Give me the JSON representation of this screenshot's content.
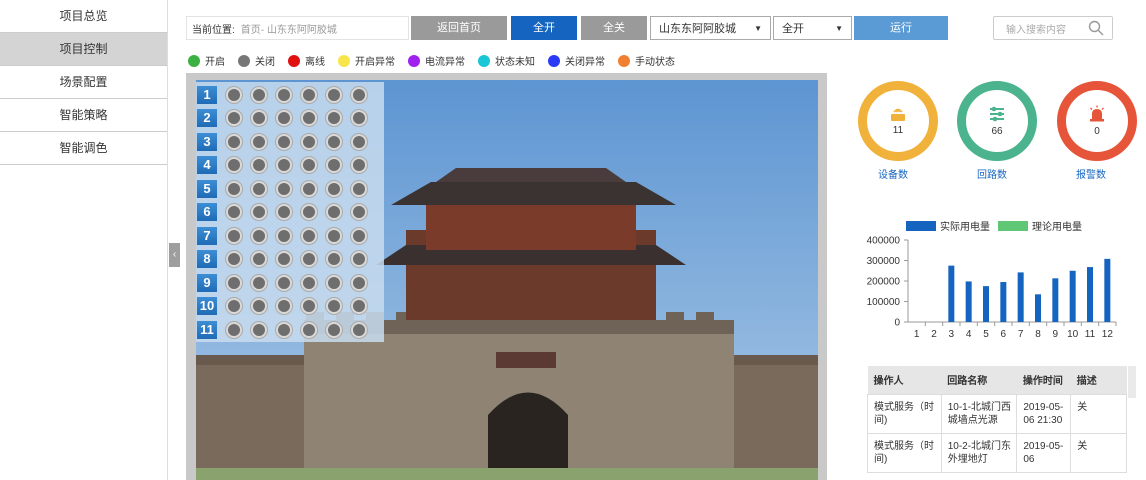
{
  "sidebar": {
    "items": [
      {
        "label": "项目总览"
      },
      {
        "label": "项目控制"
      },
      {
        "label": "场景配置"
      },
      {
        "label": "智能策略"
      },
      {
        "label": "智能调色"
      }
    ],
    "active_index": 1,
    "collapse_glyph": "‹"
  },
  "toolbar": {
    "location_label": "当前位置:",
    "location_path": "首页- 山东东阿阿胶城",
    "back_home": "返回首页",
    "all_on": "全开",
    "all_off": "全关",
    "project_select": "山东东阿阿胶城",
    "mode_select": "全开",
    "run": "运行"
  },
  "search": {
    "placeholder": "输入搜索内容",
    "icon": "search-icon"
  },
  "legend": [
    {
      "label": "开启",
      "color": "#3cb043"
    },
    {
      "label": "关闭",
      "color": "#777777"
    },
    {
      "label": "离线",
      "color": "#e01010"
    },
    {
      "label": "开启异常",
      "color": "#f7e54a"
    },
    {
      "label": "电流异常",
      "color": "#a020f0"
    },
    {
      "label": "状态未知",
      "color": "#19c6d6"
    },
    {
      "label": "关闭异常",
      "color": "#2a3af5"
    },
    {
      "label": "手动状态",
      "color": "#f08030"
    }
  ],
  "grid": {
    "rows": [
      "1",
      "2",
      "3",
      "4",
      "5",
      "6",
      "7",
      "8",
      "9",
      "10",
      "11"
    ],
    "circles_per_row": 6,
    "circle_color": "#6e6e6e"
  },
  "gauges": [
    {
      "label": "设备数",
      "value": "11",
      "color": "#f0b23a",
      "icon": "router-icon"
    },
    {
      "label": "回路数",
      "value": "66",
      "color": "#4bb38e",
      "icon": "sliders-icon"
    },
    {
      "label": "报警数",
      "value": "0",
      "color": "#e6553a",
      "icon": "alarm-icon"
    }
  ],
  "chart_data": {
    "type": "bar",
    "categories": [
      "1",
      "2",
      "3",
      "4",
      "5",
      "6",
      "7",
      "8",
      "9",
      "10",
      "11",
      "12"
    ],
    "series": [
      {
        "name": "实际用电量",
        "color": "#1565c0",
        "values": [
          0,
          0,
          275000,
          198000,
          175000,
          195000,
          242000,
          135000,
          213000,
          250000,
          268000,
          308000
        ]
      },
      {
        "name": "理论用电量",
        "color": "#5fc776",
        "values": [
          0,
          0,
          0,
          0,
          0,
          0,
          0,
          0,
          0,
          0,
          0,
          0
        ]
      }
    ],
    "yticks": [
      "400000",
      "300000",
      "200000",
      "100000",
      "0"
    ],
    "ylim": [
      0,
      400000
    ],
    "legend_position": "top"
  },
  "table": {
    "headers": [
      "操作人",
      "回路名称",
      "操作时间",
      "描述"
    ],
    "rows": [
      [
        "模式服务（时间)",
        "10-1-北城门西城墙点光源",
        "2019-05-06 21:30",
        "关"
      ],
      [
        "模式服务（时间)",
        "10-2-北城门东外埋地灯",
        "2019-05-06",
        "关"
      ]
    ]
  }
}
